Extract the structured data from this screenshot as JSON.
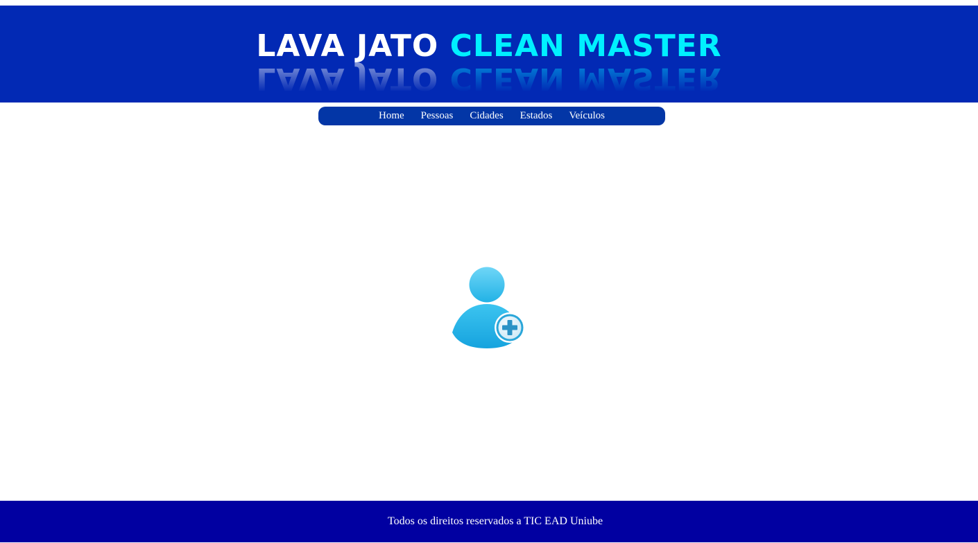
{
  "header": {
    "logo_word1": "LAVA JATO",
    "logo_word2": "CLEAN MASTER",
    "background_color": "#0229b4",
    "word1_color": "#ffffff",
    "word2_color": "#00f0ff"
  },
  "nav": {
    "background_color": "#0336a6",
    "items": [
      {
        "label": "Home"
      },
      {
        "label": "Pessoas"
      },
      {
        "label": "Cidades"
      },
      {
        "label": "Estados"
      },
      {
        "label": "Veículos"
      }
    ]
  },
  "main": {
    "icon": "add-user-icon"
  },
  "footer": {
    "text": "Todos os direitos reservados a TIC EAD Uniube",
    "background_color": "#0100a1"
  }
}
